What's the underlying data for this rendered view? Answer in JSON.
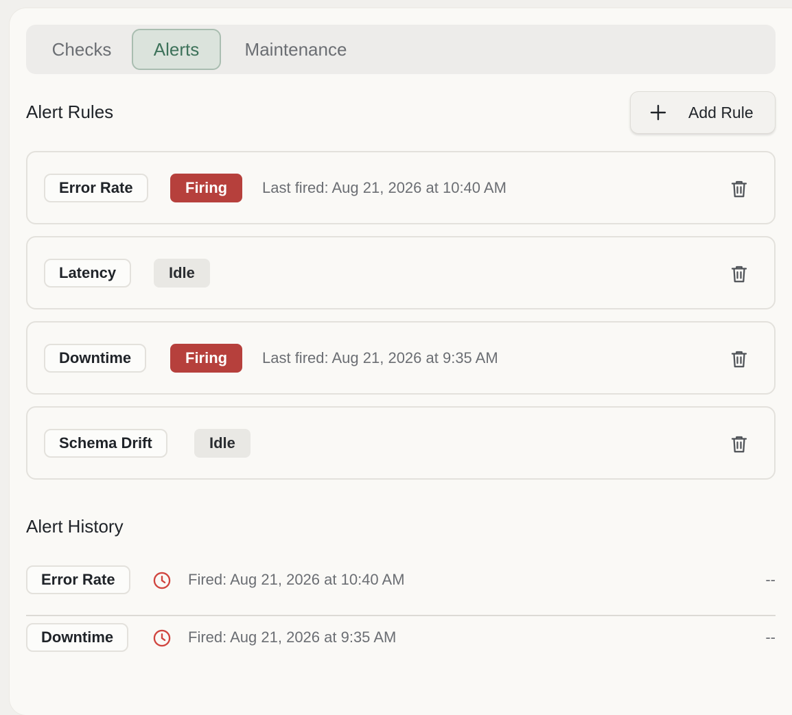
{
  "tabs": {
    "checks": "Checks",
    "alerts": "Alerts",
    "maintenance": "Maintenance"
  },
  "alert_rules": {
    "title": "Alert Rules",
    "add_rule_label": "Add Rule",
    "rules": [
      {
        "name": "Error Rate",
        "status": "Firing",
        "last_fired": "Last fired: Aug 21, 2026 at 10:40 AM"
      },
      {
        "name": "Latency",
        "status": "Idle",
        "last_fired": ""
      },
      {
        "name": "Downtime",
        "status": "Firing",
        "last_fired": "Last fired: Aug 21, 2026 at 9:35 AM"
      },
      {
        "name": "Schema Drift",
        "status": "Idle",
        "last_fired": ""
      }
    ]
  },
  "alert_history": {
    "title": "Alert History",
    "entries": [
      {
        "name": "Error Rate",
        "fired": "Fired: Aug 21, 2026 at 10:40 AM",
        "resolved": "--"
      },
      {
        "name": "Downtime",
        "fired": "Fired: Aug 21, 2026 at 9:35 AM",
        "resolved": "--"
      }
    ]
  },
  "icons": {
    "add": "plus-icon",
    "delete": "trash-icon",
    "history": "clock-icon"
  },
  "colors": {
    "firing": "#b6403c",
    "idle": "#e9e8e4",
    "active_tab_text": "#3d725a",
    "clock": "#d0443e"
  }
}
